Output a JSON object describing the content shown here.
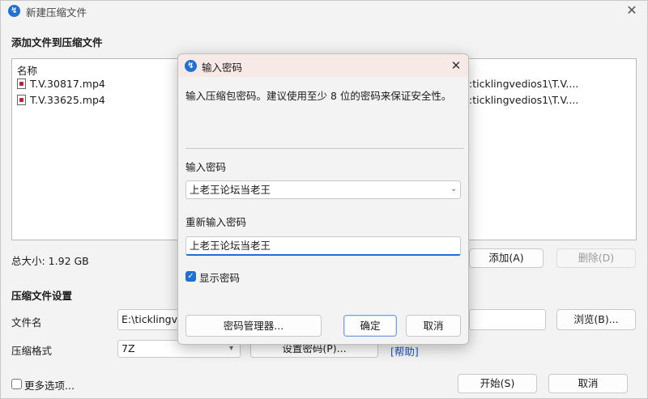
{
  "window": {
    "title": "新建压缩文件",
    "add_files_heading": "添加文件到压缩文件",
    "file_list": {
      "column_header": "名称",
      "files": [
        {
          "name": "T.V.30817.mp4",
          "path": ":ticklingvedios1\\T.V...."
        },
        {
          "name": "T.V.33625.mp4",
          "path": ":ticklingvedios1\\T.V...."
        }
      ]
    },
    "total_size": "总大小: 1.92 GB",
    "add_button": "添加(A)",
    "delete_button": "删除(D)",
    "settings_heading": "压缩文件设置",
    "filename_label": "文件名",
    "filename_value": "E:\\ticklingve",
    "browse_button": "浏览(B)...",
    "format_label": "压缩格式",
    "format_value": "7Z",
    "set_password_button": "设置密码(P)...",
    "help_link": "[帮助]",
    "more_options_label": "更多选项...",
    "start_button": "开始(S)",
    "cancel_button": "取消"
  },
  "dialog": {
    "title": "输入密码",
    "description": "输入压缩包密码。建议使用至少 8 位的密码来保证安全性。",
    "password_label": "输入密码",
    "password_value": "上老王论坛当老王",
    "reenter_label": "重新输入密码",
    "reenter_value": "上老王论坛当老王",
    "show_password_label": "显示密码",
    "show_password_checked": true,
    "password_manager_button": "密码管理器...",
    "ok_button": "确定",
    "cancel_button": "取消"
  },
  "colors": {
    "accent": "#1f6fd6",
    "dialog_titlebar": "#f7eae6",
    "link": "#1a4fbf"
  }
}
